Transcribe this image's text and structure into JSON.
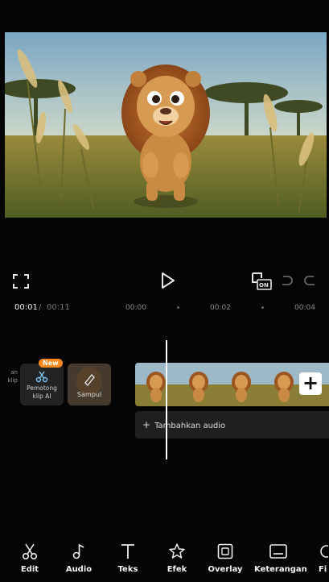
{
  "timebar": {
    "current": "00:01",
    "separator": "/",
    "total": "00:11",
    "ticks": [
      "00:00",
      "00:02",
      "00:04"
    ]
  },
  "timeline": {
    "left_partial": [
      "an",
      "klip"
    ],
    "ai_cutter_label": [
      "Pemotong",
      "klip AI"
    ],
    "new_badge": "New",
    "cover_label": "Sampul",
    "add_audio_label": "Tambahkan audio",
    "add_clip_symbol": "+"
  },
  "controls": {
    "keyframe_on": "ON"
  },
  "toolbar": {
    "items": [
      {
        "label": "Edit",
        "icon": "scissors-icon"
      },
      {
        "label": "Audio",
        "icon": "music-note-icon"
      },
      {
        "label": "Teks",
        "icon": "text-icon"
      },
      {
        "label": "Efek",
        "icon": "star-effect-icon"
      },
      {
        "label": "Overlay",
        "icon": "overlay-icon"
      },
      {
        "label": "Keterangan",
        "icon": "caption-icon"
      },
      {
        "label": "Fi",
        "icon": "filter-icon"
      }
    ]
  },
  "colors": {
    "background": "#050505",
    "new_badge": "#ff8a1f",
    "playhead": "#ffffff"
  }
}
